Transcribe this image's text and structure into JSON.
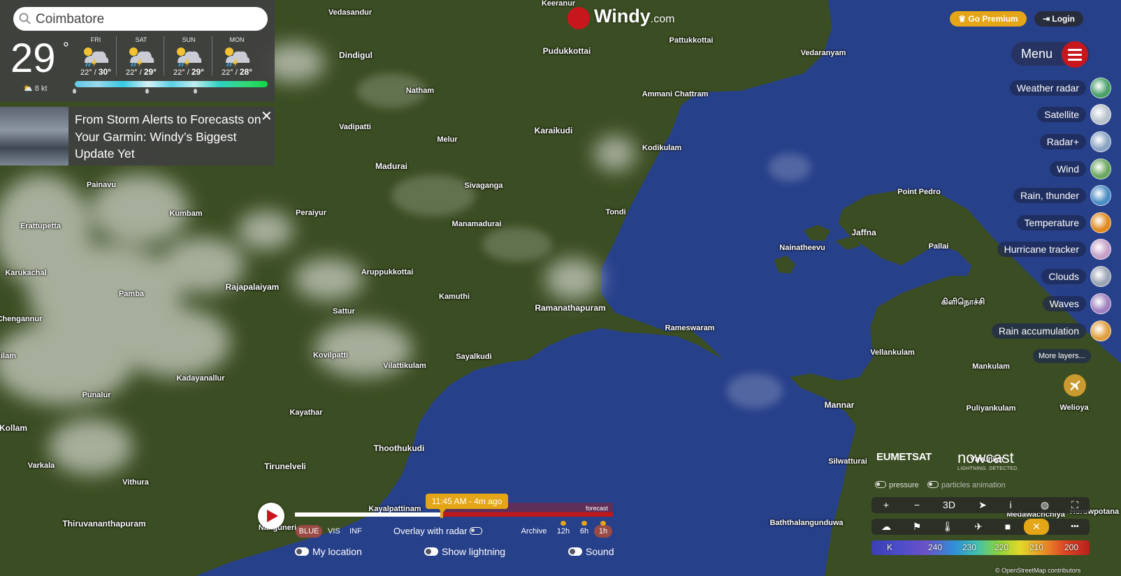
{
  "search": {
    "value": "Coimbatore"
  },
  "current": {
    "temp": "29",
    "unit": "°",
    "wind": "8 kt"
  },
  "forecast_days": [
    {
      "day": "FRI",
      "low": "22°",
      "high": "30°"
    },
    {
      "day": "SAT",
      "low": "22°",
      "high": "29°"
    },
    {
      "day": "SUN",
      "low": "22°",
      "high": "29°"
    },
    {
      "day": "MON",
      "low": "22°",
      "high": "28°"
    }
  ],
  "news": {
    "headline": "From Storm Alerts to Forecasts on Your Garmin: Windy’s Biggest Update Yet",
    "close": "✕"
  },
  "logo": {
    "name": "Windy",
    "suffix": ".com"
  },
  "header": {
    "premium": "Go Premium",
    "login": "Login",
    "menu": "Menu"
  },
  "layers": [
    {
      "label": "Weather radar",
      "icon": "radar-icon",
      "color": "#4aa06a"
    },
    {
      "label": "Satellite",
      "icon": "satellite-icon",
      "color": "#b8c2cc"
    },
    {
      "label": "Radar+",
      "icon": "radar-plus-icon",
      "color": "#8aa4c4"
    },
    {
      "label": "Wind",
      "icon": "wind-icon",
      "color": "#6aa860"
    },
    {
      "label": "Rain, thunder",
      "icon": "rain-thunder-icon",
      "color": "#4a8cc4"
    },
    {
      "label": "Temperature",
      "icon": "temperature-icon",
      "color": "#e08a20"
    },
    {
      "label": "Hurricane tracker",
      "icon": "hurricane-icon",
      "color": "#c4a0c8"
    },
    {
      "label": "Clouds",
      "icon": "clouds-icon",
      "color": "#9aa4b4"
    },
    {
      "label": "Waves",
      "icon": "waves-icon",
      "color": "#a080c0"
    },
    {
      "label": "Rain accumulation",
      "icon": "rain-accumulation-icon",
      "color": "#e0a040"
    }
  ],
  "more_layers": "More layers...",
  "places": [
    {
      "name": "Keeranur",
      "small": true
    },
    {
      "name": "Vedasandur",
      "small": true
    },
    {
      "name": "Pattukkottai",
      "small": true
    },
    {
      "name": "Dindigul",
      "small": false
    },
    {
      "name": "Pudukkottai",
      "small": false
    },
    {
      "name": "Vedaranyam",
      "small": true
    },
    {
      "name": "Natham",
      "small": true
    },
    {
      "name": "Ammani Chattram",
      "small": true
    },
    {
      "name": "Vadipatti",
      "small": true
    },
    {
      "name": "Melur",
      "small": true
    },
    {
      "name": "Karaikudi",
      "small": false
    },
    {
      "name": "Kodikulam",
      "small": true
    },
    {
      "name": "Madurai",
      "small": false
    },
    {
      "name": "Painavu",
      "small": true
    },
    {
      "name": "Sivaganga",
      "small": true
    },
    {
      "name": "Point Pedro",
      "small": true
    },
    {
      "name": "Kumbam",
      "small": true
    },
    {
      "name": "Peraiyur",
      "small": true
    },
    {
      "name": "Tondi",
      "small": true
    },
    {
      "name": "Manamadurai",
      "small": true
    },
    {
      "name": "Erattupetta",
      "small": true
    },
    {
      "name": "Jaffna",
      "small": false
    },
    {
      "name": "Nainatheevu",
      "small": true
    },
    {
      "name": "Pallai",
      "small": true
    },
    {
      "name": "Karukachal",
      "small": true
    },
    {
      "name": "Aruppukkottai",
      "small": true
    },
    {
      "name": "Rajapalaiyam",
      "small": false
    },
    {
      "name": "Pamba",
      "small": true
    },
    {
      "name": "Kamuthi",
      "small": true
    },
    {
      "name": "கிளிநொச்சி",
      "small": false
    },
    {
      "name": "Ramanathapuram",
      "small": false
    },
    {
      "name": "Sattur",
      "small": true
    },
    {
      "name": "Chengannur",
      "small": true
    },
    {
      "name": "Rameswaram",
      "small": true
    },
    {
      "name": "Kovilpatti",
      "small": true
    },
    {
      "name": "Sayalkudi",
      "small": true
    },
    {
      "name": "Vilattikulam",
      "small": true
    },
    {
      "name": "Vellankulam",
      "small": true
    },
    {
      "name": "Mankulam",
      "small": true
    },
    {
      "name": "Kadayanallur",
      "small": true
    },
    {
      "name": "Punalur",
      "small": true
    },
    {
      "name": "Mannar",
      "small": false
    },
    {
      "name": "Puliyankulam",
      "small": true
    },
    {
      "name": "Welioya",
      "small": true
    },
    {
      "name": "Kayathar",
      "small": true
    },
    {
      "name": "Kollam",
      "small": false
    },
    {
      "name": "Thoothukudi",
      "small": false
    },
    {
      "name": "Silwatturai",
      "small": true
    },
    {
      "name": "Vavuniya",
      "small": true
    },
    {
      "name": "Varkala",
      "small": true
    },
    {
      "name": "Tirunelveli",
      "small": false
    },
    {
      "name": "Vithura",
      "small": true
    },
    {
      "name": "Kayalpattinam",
      "small": true
    },
    {
      "name": "Medawachchiya",
      "small": true
    },
    {
      "name": "Horowpotana",
      "small": true
    },
    {
      "name": "Thiruvananthapuram",
      "small": false
    },
    {
      "name": "Nanguneri",
      "small": true
    },
    {
      "name": "Baththalangunduwa",
      "small": true
    },
    {
      "name": "Kilam",
      "small": true
    }
  ],
  "attribution": {
    "eumetsat": "EUMETSAT",
    "nowcast": "nowcast",
    "nowcast_sub": "LIGHTNING. DETECTED.",
    "osm": "© OpenStreetMap contributors"
  },
  "map_options": {
    "pressure": "pressure",
    "particles": "particles animation"
  },
  "toolbar1": [
    "+",
    "−",
    "3D",
    "➤",
    "i",
    "◍",
    "⛶"
  ],
  "toolbar1_icons": [
    "zoom-in-icon",
    "zoom-out-icon",
    "3d-button",
    "locate-icon",
    "info-icon",
    "hurricane-icon",
    "fullscreen-icon"
  ],
  "toolbar2_icons": [
    "weather-icon",
    "flag-icon",
    "thermometer-icon",
    "plane-icon",
    "webcam-icon",
    "close-icon",
    "more-icon"
  ],
  "legend": {
    "unit": "K",
    "ticks": [
      "240",
      "230",
      "220",
      "210",
      "200"
    ]
  },
  "timeline": {
    "time": "11:45 AM - 4m ago",
    "forecast": "forecast",
    "modes": [
      "BLUE",
      "VIS",
      "INF"
    ],
    "overlay": "Overlay with radar",
    "archive": "Archive",
    "ranges": [
      "12h",
      "6h",
      "1h"
    ],
    "toggles": [
      "My location",
      "Show lightning",
      "Sound"
    ]
  },
  "colors": {
    "land": "#3b4d22",
    "sea": "#27408a",
    "accent": "#c8161d",
    "premium": "#e4a516"
  }
}
